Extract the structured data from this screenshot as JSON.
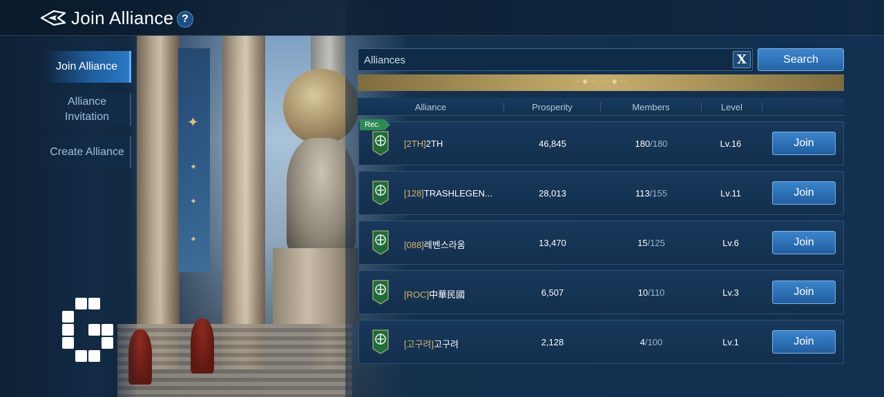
{
  "header": {
    "title": "Join Alliance",
    "help_label": "?"
  },
  "menu": {
    "items": [
      {
        "label": "Join Alliance",
        "active": true
      },
      {
        "label": "Alliance Invitation",
        "active": false
      },
      {
        "label": "Create Alliance",
        "active": false
      }
    ]
  },
  "search": {
    "placeholder": "Alliances",
    "clear_label": "X",
    "button_label": "Search"
  },
  "table": {
    "columns": [
      "Alliance",
      "Prosperity",
      "Members",
      "Level"
    ],
    "rec_badge": "Rec.",
    "rows": [
      {
        "tag": "[2TH]",
        "name": "2TH",
        "prosperity": "46,845",
        "members": "180",
        "max_members": "/180",
        "level": "Lv.16",
        "join": "Join"
      },
      {
        "tag": "[128]",
        "name": "TRASHLEGEN...",
        "prosperity": "28,013",
        "members": "113",
        "max_members": "/155",
        "level": "Lv.11",
        "join": "Join"
      },
      {
        "tag": "[088]",
        "name": "레벤스라움",
        "prosperity": "13,470",
        "members": "15",
        "max_members": "/125",
        "level": "Lv.6",
        "join": "Join"
      },
      {
        "tag": "[ROC]",
        "name": "中華民國",
        "prosperity": "6,507",
        "members": "10",
        "max_members": "/110",
        "level": "Lv.3",
        "join": "Join"
      },
      {
        "tag": "[고구려]",
        "name": "고구려",
        "prosperity": "2,128",
        "members": "4",
        "max_members": "/100",
        "level": "Lv.1",
        "join": "Join"
      }
    ]
  },
  "colors": {
    "accent": "#2b78c4",
    "tag_gold": "#d9b46b",
    "rec_green": "#2e8a55"
  },
  "icons": [
    "back-arrow-icon",
    "help-icon",
    "close-icon",
    "alliance-emblem-icon",
    "logo-icon"
  ]
}
